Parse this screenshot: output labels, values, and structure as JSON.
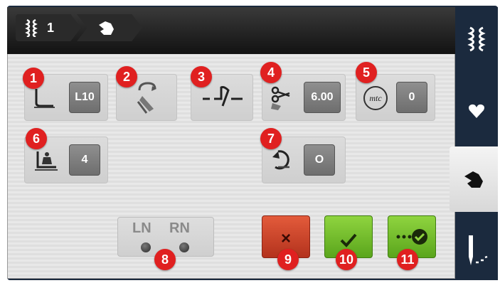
{
  "breadcrumb": {
    "stitch_number": "1",
    "stitch_icon": "stitch-pattern-icon",
    "settings_icon": "hand-icon"
  },
  "settings": {
    "presser_foot": {
      "badge": "1",
      "value": "L10",
      "icon": "presser-foot-icon"
    },
    "foot_indicator": {
      "badge": "2",
      "icon": "foot-indicator-icon"
    },
    "securing": {
      "badge": "3",
      "icon": "securing-stitch-icon"
    },
    "thread_cutter": {
      "badge": "4",
      "value": "6.00",
      "icon": "scissors-icon"
    },
    "mtc": {
      "badge": "5",
      "value": "0",
      "icon_text": "mtc"
    },
    "foot_pressure": {
      "badge": "6",
      "value": "4",
      "icon": "foot-pressure-icon"
    },
    "pattern_repeat": {
      "badge": "7",
      "value": "O",
      "icon": "pattern-repeat-icon"
    }
  },
  "needle_position": {
    "badge": "8",
    "left_label": "LN",
    "right_label": "RN"
  },
  "buttons": {
    "cancel": {
      "badge": "9",
      "label": "×"
    },
    "confirm": {
      "badge": "10",
      "label": "✓",
      "icon": "checkmark-icon"
    },
    "confirm_all": {
      "badge": "11",
      "icon": "confirm-all-icon"
    }
  },
  "sidebar": {
    "tabs": [
      {
        "icon": "stitch-pattern-icon"
      },
      {
        "icon": "heart-icon"
      },
      {
        "icon": "hand-icon",
        "active": true
      },
      {
        "icon": "needle-icon"
      }
    ]
  },
  "colors": {
    "badge": "#e02020",
    "cancel_button": "#c93d24",
    "confirm_button": "#6fba27",
    "sidebar": "#1b2a3e"
  }
}
